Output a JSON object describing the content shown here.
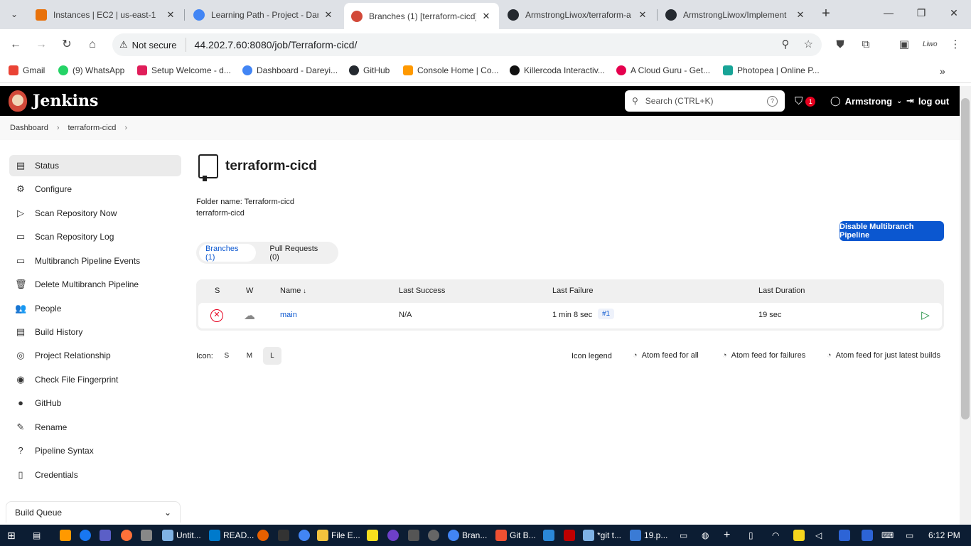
{
  "browser": {
    "tabs": [
      {
        "title": "Instances | EC2 | us-east-1",
        "color": "#e8710a"
      },
      {
        "title": "Learning Path - Project - Dar",
        "color": "#4285f4"
      },
      {
        "title": "Branches (1) [terraform-cicd]",
        "color": "#d24939"
      },
      {
        "title": "ArmstrongLiwox/terraform-a",
        "color": "#24292f"
      },
      {
        "title": "ArmstrongLiwox/Implement",
        "color": "#24292f"
      }
    ],
    "not_secure": "Not secure",
    "url": "44.202.7.60:8080/job/Terraform-cicd/",
    "bookmarks": [
      {
        "label": "Gmail",
        "color": "#ea4335"
      },
      {
        "label": "(9) WhatsApp",
        "color": "#25d366"
      },
      {
        "label": "Setup Welcome - d...",
        "color": "#e01e5a"
      },
      {
        "label": "Dashboard - Dareyi...",
        "color": "#4285f4"
      },
      {
        "label": "GitHub",
        "color": "#24292f"
      },
      {
        "label": "Console Home | Co...",
        "color": "#ff9900"
      },
      {
        "label": "Killercoda Interactiv...",
        "color": "#111111"
      },
      {
        "label": "A Cloud Guru - Get...",
        "color": "#e5004e"
      },
      {
        "label": "Photopea | Online P...",
        "color": "#18a497"
      }
    ]
  },
  "jenkins": {
    "logo": "Jenkins",
    "search_placeholder": "Search (CTRL+K)",
    "security_count": "1",
    "user": "Armstrong",
    "logout": "log out",
    "breadcrumb": [
      "Dashboard",
      "terraform-cicd"
    ]
  },
  "sidebar": {
    "items": [
      {
        "label": "Status",
        "icon": "▤"
      },
      {
        "label": "Configure",
        "icon": "⚙"
      },
      {
        "label": "Scan Repository Now",
        "icon": "▷"
      },
      {
        "label": "Scan Repository Log",
        "icon": "▭"
      },
      {
        "label": "Multibranch Pipeline Events",
        "icon": "▭"
      },
      {
        "label": "Delete Multibranch Pipeline",
        "icon": "🗑"
      },
      {
        "label": "People",
        "icon": "👥"
      },
      {
        "label": "Build History",
        "icon": "▤"
      },
      {
        "label": "Project Relationship",
        "icon": "◎"
      },
      {
        "label": "Check File Fingerprint",
        "icon": "◉"
      },
      {
        "label": "GitHub",
        "icon": "●"
      },
      {
        "label": "Rename",
        "icon": "✎"
      },
      {
        "label": "Pipeline Syntax",
        "icon": "?"
      },
      {
        "label": "Credentials",
        "icon": "▯"
      }
    ],
    "build_queue": "Build Queue"
  },
  "main": {
    "title": "terraform-cicd",
    "folder_name": "Folder name: Terraform-cicd",
    "description": "terraform-cicd",
    "disable_button": "Disable Multibranch Pipeline",
    "tabs": [
      "Branches (1)",
      "Pull Requests (0)"
    ],
    "table": {
      "headers": {
        "s": "S",
        "w": "W",
        "name": "Name",
        "sort": "↓",
        "last_success": "Last Success",
        "last_failure": "Last Failure",
        "last_duration": "Last Duration"
      },
      "rows": [
        {
          "name": "main",
          "last_success": "N/A",
          "last_failure": "1 min 8 sec",
          "build": "#1",
          "last_duration": "19 sec"
        }
      ]
    },
    "icon_label": "Icon:",
    "icon_sizes": [
      "S",
      "M",
      "L"
    ],
    "icon_legend": "Icon legend",
    "feeds": [
      "Atom feed for all",
      "Atom feed for failures",
      "Atom feed for just latest builds"
    ]
  },
  "taskbar": {
    "items": [
      "Untit...",
      "READ...",
      "File E...",
      "Bran...",
      "Git B...",
      "*git t...",
      "19.p..."
    ],
    "time": "6:12 PM"
  }
}
